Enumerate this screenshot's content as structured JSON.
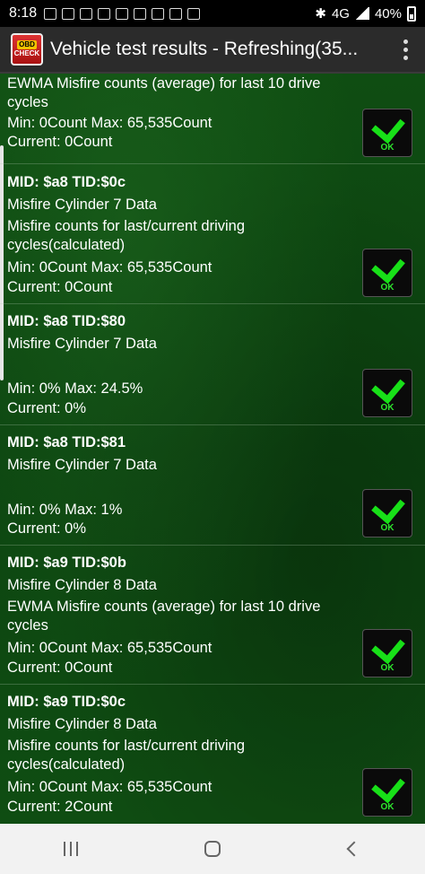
{
  "status_bar": {
    "time": "8:18",
    "network": "4G",
    "battery": "40%"
  },
  "app_bar": {
    "title": "Vehicle test results - Refreshing(35..."
  },
  "results": [
    {
      "mid": "",
      "name": "",
      "description": "EWMA Misfire counts (average) for last 10 drive",
      "description2": "cycles",
      "range": "Min: 0Count  Max: 65,535Count",
      "current": "Current: 0Count",
      "status": "OK"
    },
    {
      "mid": "MID: $a8 TID:$0c",
      "name": "Misfire Cylinder 7 Data",
      "description": "Misfire counts for last/current driving",
      "description2": "cycles(calculated)",
      "range": "Min: 0Count  Max: 65,535Count",
      "current": "Current: 0Count",
      "status": "OK"
    },
    {
      "mid": "MID: $a8 TID:$80",
      "name": "Misfire Cylinder 7 Data",
      "description": "",
      "description2": "",
      "range": "Min: 0%  Max: 24.5%",
      "current": "Current: 0%",
      "status": "OK"
    },
    {
      "mid": "MID: $a8 TID:$81",
      "name": "Misfire Cylinder 7 Data",
      "description": "",
      "description2": "",
      "range": "Min: 0%  Max: 1%",
      "current": "Current: 0%",
      "status": "OK"
    },
    {
      "mid": "MID: $a9 TID:$0b",
      "name": "Misfire Cylinder 8 Data",
      "description": "EWMA Misfire counts (average) for last 10 drive",
      "description2": "cycles",
      "range": "Min: 0Count  Max: 65,535Count",
      "current": "Current: 0Count",
      "status": "OK"
    },
    {
      "mid": "MID: $a9 TID:$0c",
      "name": "Misfire Cylinder 8 Data",
      "description": "Misfire counts for last/current driving",
      "description2": "cycles(calculated)",
      "range": "Min: 0Count  Max: 65,535Count",
      "current": "Current: 2Count",
      "status": "OK"
    }
  ],
  "colors": {
    "background": "#0f4d12",
    "ok_green": "#18e018",
    "app_bar": "#2b2b2b"
  }
}
